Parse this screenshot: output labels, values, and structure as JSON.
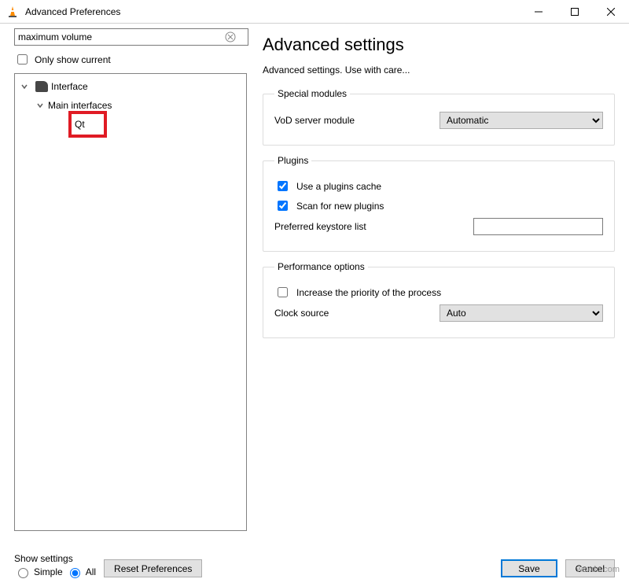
{
  "window": {
    "title": "Advanced Preferences"
  },
  "search": {
    "value": "maximum volume",
    "only_show_label": "Only show current"
  },
  "tree": {
    "items": [
      {
        "label": "Interface"
      },
      {
        "label": "Main interfaces"
      },
      {
        "label": "Qt"
      }
    ]
  },
  "right": {
    "heading": "Advanced settings",
    "subtitle": "Advanced settings. Use with care...",
    "groups": {
      "special": {
        "legend": "Special modules",
        "vod_label": "VoD server module",
        "vod_value": "Automatic"
      },
      "plugins": {
        "legend": "Plugins",
        "cache_label": "Use a plugins cache",
        "scan_label": "Scan for new plugins",
        "keystore_label": "Preferred keystore list",
        "keystore_value": ""
      },
      "perf": {
        "legend": "Performance options",
        "priority_label": "Increase the priority of the process",
        "clock_label": "Clock source",
        "clock_value": "Auto"
      }
    }
  },
  "footer": {
    "show_settings_label": "Show settings",
    "simple_label": "Simple",
    "all_label": "All",
    "reset_label": "Reset Preferences",
    "save_label": "Save",
    "cancel_label": "Cancel"
  },
  "watermark": "wsxdn.com"
}
